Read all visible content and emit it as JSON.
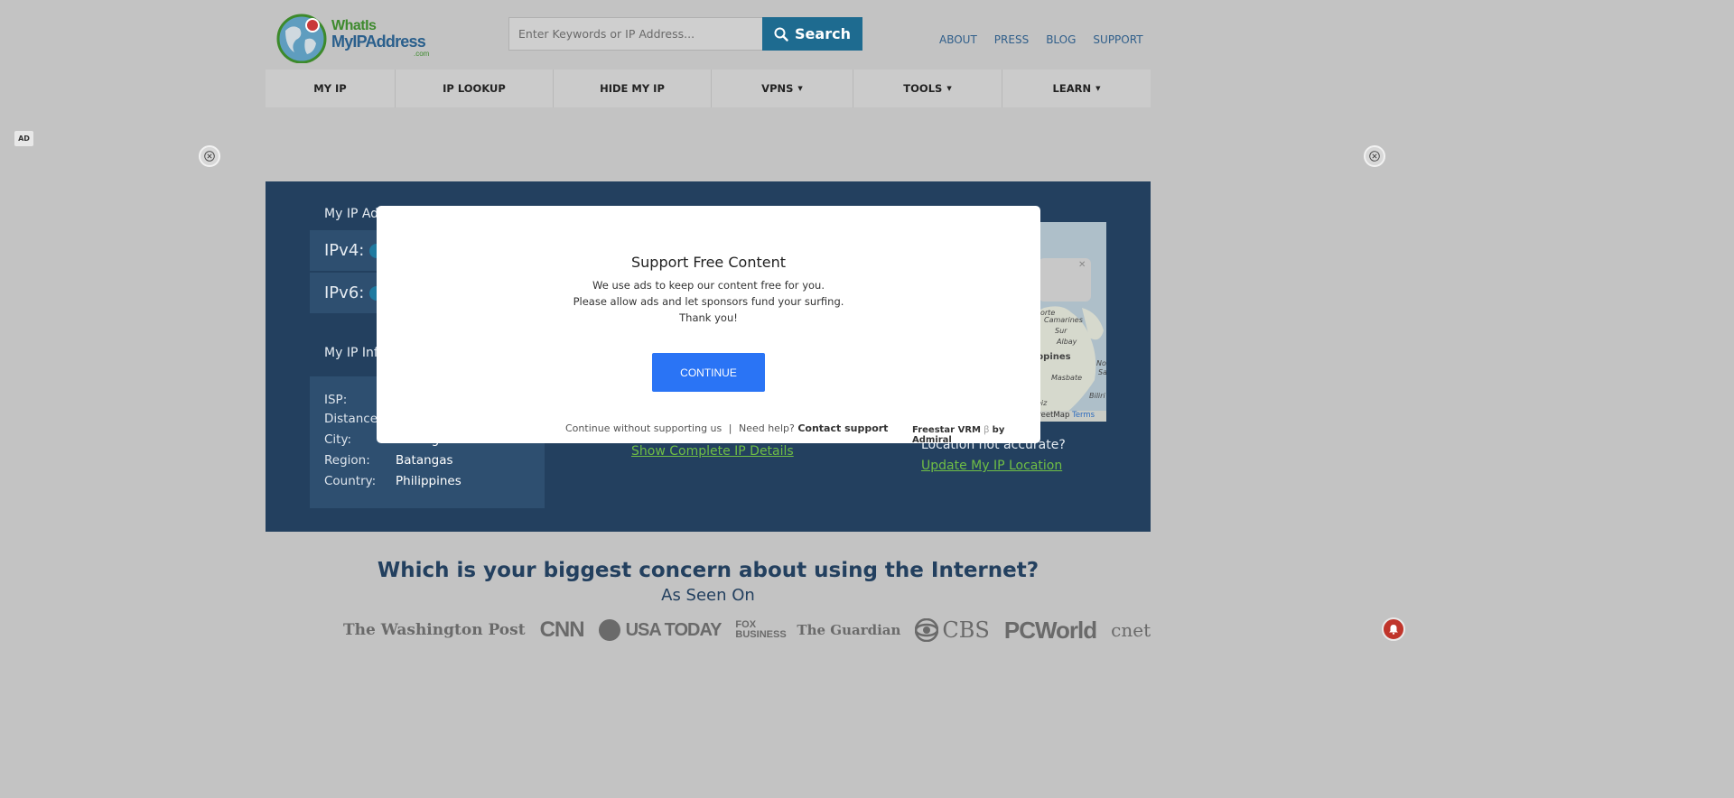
{
  "header": {
    "logo": {
      "line1": "WhatIs",
      "line2": "MyIPAddress",
      "line3": ".com"
    },
    "search": {
      "placeholder": "Enter Keywords or IP Address...",
      "button_label": "Search"
    },
    "top_links": [
      "ABOUT",
      "PRESS",
      "BLOG",
      "SUPPORT"
    ]
  },
  "nav": {
    "items": [
      {
        "label": "MY IP",
        "dropdown": false
      },
      {
        "label": "IP LOOKUP",
        "dropdown": false
      },
      {
        "label": "HIDE MY IP",
        "dropdown": false
      },
      {
        "label": "VPNS",
        "dropdown": true
      },
      {
        "label": "TOOLS",
        "dropdown": true
      },
      {
        "label": "LEARN",
        "dropdown": true
      }
    ],
    "caret": "▼"
  },
  "ad": {
    "badge": "AD"
  },
  "hero": {
    "ip_heading": "My IP Ad",
    "ipv4_label": "IPv4:",
    "ipv6_label": "IPv6:",
    "help_glyph": "?",
    "info_heading": "My IP Inf",
    "info_rows": [
      {
        "label": "ISP:",
        "value": ""
      },
      {
        "label": "Distance",
        "value": ""
      },
      {
        "label": "City:",
        "value": "Batangas"
      },
      {
        "label": "Region:",
        "value": "Batangas"
      },
      {
        "label": "Country:",
        "value": "Philippines"
      }
    ],
    "show_details_link": "Show Complete IP Details",
    "location_question": "Location not accurate?",
    "update_location_link": "Update My IP Location",
    "map": {
      "labels": [
        "orte",
        "Camarines",
        "Sur",
        "Albay",
        "ppines",
        "Masbate",
        "Biliri",
        "No",
        "Sa",
        "eiz"
      ],
      "attribution": "treetMap",
      "terms": "Terms",
      "close_glyph": "✕"
    }
  },
  "bottom": {
    "question": "Which is your biggest concern about using the Internet?",
    "as_seen_on": "As Seen On",
    "press_logos": [
      "The Washington Post",
      "CNN",
      "USA TODAY",
      "FOX BUSINESS",
      "The Guardian",
      "CBS",
      "PCWorld",
      "cnet"
    ]
  },
  "modal": {
    "title": "Support Free Content",
    "lines": [
      "We use ads to keep our content free for you.",
      "Please allow ads and let sponsors fund your surfing.",
      "Thank you!"
    ],
    "continue_label": "CONTINUE",
    "continue_without": "Continue without supporting us",
    "separator": "|",
    "need_help": "Need help?",
    "contact_support": "Contact support",
    "vendor": "Freestar VRM",
    "by": "by Admiral"
  },
  "colors": {
    "overlay_bg": "#c3c3c3",
    "hero_bg": "#23405f",
    "search_button": "#1e6b90",
    "continue_button": "#2a74f5",
    "link_green": "#6fbe45",
    "heading_navy": "#23405f"
  }
}
